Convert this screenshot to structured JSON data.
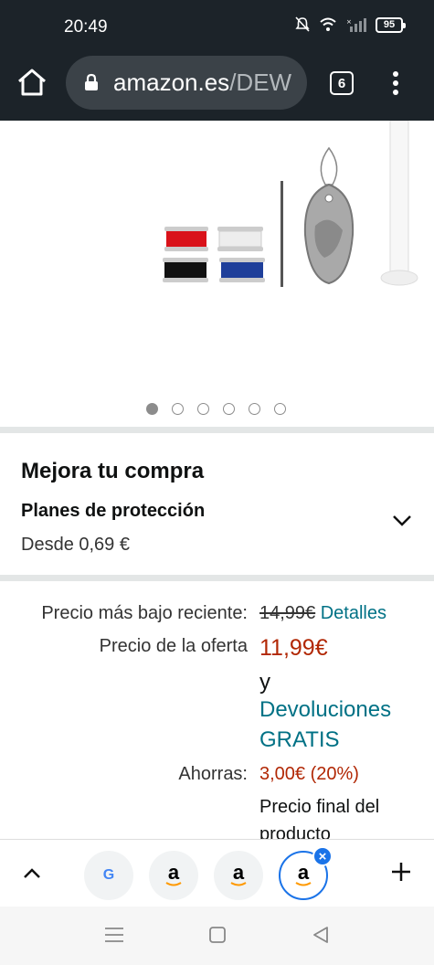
{
  "status_bar": {
    "time": "20:49",
    "battery": "95"
  },
  "browser": {
    "url_domain": "amazon.es",
    "url_path": "/DEW",
    "tab_count": "6"
  },
  "gallery": {
    "dot_count": 6,
    "active_index": 0
  },
  "upgrade": {
    "title": "Mejora tu compra",
    "plan_title": "Planes de protección",
    "plan_price": "Desde 0,69 €"
  },
  "pricing": {
    "recent_low_label": "Precio más bajo reciente:",
    "recent_low_value": "14,99€",
    "details_link": "Detalles",
    "deal_label": "Precio de la oferta",
    "deal_value": "11,99€",
    "and": "y",
    "returns_line1": "Devoluciones",
    "returns_line2": "GRATIS",
    "savings_label": "Ahorras:",
    "savings_value": "3,00€ (20%)",
    "final_line1": "Precio final del",
    "final_line2": "producto"
  },
  "tab_strip": {
    "tabs": [
      "G",
      "a",
      "a",
      "a"
    ],
    "selected_index": 3
  },
  "colors": {
    "chrome_bg": "#1c2329",
    "link": "#007185",
    "price_red": "#b12704",
    "tab_selected": "#1a73e8"
  }
}
